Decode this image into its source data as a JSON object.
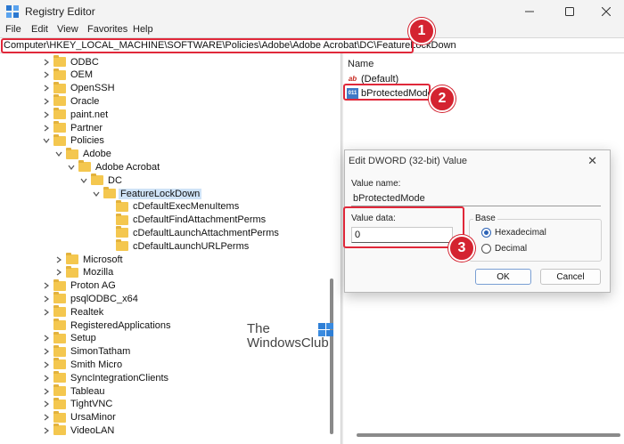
{
  "window": {
    "title": "Registry Editor"
  },
  "menu": [
    "File",
    "Edit",
    "View",
    "Favorites",
    "Help"
  ],
  "address": {
    "path": "Computer\\HKEY_LOCAL_MACHINE\\SOFTWARE\\Policies\\Adobe\\Adobe Acrobat\\DC\\FeatureLockDown"
  },
  "tree": {
    "items": [
      {
        "label": "ODBC",
        "depth": 0,
        "expander": "collapsed"
      },
      {
        "label": "OEM",
        "depth": 0,
        "expander": "collapsed"
      },
      {
        "label": "OpenSSH",
        "depth": 0,
        "expander": "collapsed"
      },
      {
        "label": "Oracle",
        "depth": 0,
        "expander": "collapsed"
      },
      {
        "label": "paint.net",
        "depth": 0,
        "expander": "collapsed"
      },
      {
        "label": "Partner",
        "depth": 0,
        "expander": "collapsed"
      },
      {
        "label": "Policies",
        "depth": 0,
        "expander": "expanded"
      },
      {
        "label": "Adobe",
        "depth": 1,
        "expander": "expanded"
      },
      {
        "label": "Adobe Acrobat",
        "depth": 2,
        "expander": "expanded"
      },
      {
        "label": "DC",
        "depth": 3,
        "expander": "expanded"
      },
      {
        "label": "FeatureLockDown",
        "depth": 4,
        "expander": "expanded",
        "selected": true
      },
      {
        "label": "cDefaultExecMenuItems",
        "depth": 5,
        "expander": "none"
      },
      {
        "label": "cDefaultFindAttachmentPerms",
        "depth": 5,
        "expander": "none"
      },
      {
        "label": "cDefaultLaunchAttachmentPerms",
        "depth": 5,
        "expander": "none"
      },
      {
        "label": "cDefaultLaunchURLPerms",
        "depth": 5,
        "expander": "none"
      },
      {
        "label": "Microsoft",
        "depth": 1,
        "expander": "collapsed"
      },
      {
        "label": "Mozilla",
        "depth": 1,
        "expander": "collapsed"
      },
      {
        "label": "Proton AG",
        "depth": 0,
        "expander": "collapsed"
      },
      {
        "label": "psqlODBC_x64",
        "depth": 0,
        "expander": "collapsed"
      },
      {
        "label": "Realtek",
        "depth": 0,
        "expander": "collapsed"
      },
      {
        "label": "RegisteredApplications",
        "depth": 0,
        "expander": "none"
      },
      {
        "label": "Setup",
        "depth": 0,
        "expander": "collapsed"
      },
      {
        "label": "SimonTatham",
        "depth": 0,
        "expander": "collapsed"
      },
      {
        "label": "Smith Micro",
        "depth": 0,
        "expander": "collapsed"
      },
      {
        "label": "SyncIntegrationClients",
        "depth": 0,
        "expander": "collapsed"
      },
      {
        "label": "Tableau",
        "depth": 0,
        "expander": "collapsed"
      },
      {
        "label": "TightVNC",
        "depth": 0,
        "expander": "collapsed"
      },
      {
        "label": "UrsaMinor",
        "depth": 0,
        "expander": "collapsed"
      },
      {
        "label": "VideoLAN",
        "depth": 0,
        "expander": "collapsed"
      }
    ]
  },
  "values": {
    "column_name": "Name",
    "rows": [
      {
        "label": "(Default)",
        "icon": "string-value-icon",
        "icon_text": "ab"
      },
      {
        "label": "bProtectedMode",
        "icon": "dword-value-icon",
        "icon_text": "011"
      }
    ]
  },
  "dialog": {
    "title": "Edit DWORD (32-bit) Value",
    "close_glyph": "✕",
    "value_name_label": "Value name:",
    "value_name": "bProtectedMode",
    "value_data_label": "Value data:",
    "value_data": "0",
    "base_label": "Base",
    "hex_label": "Hexadecimal",
    "dec_label": "Decimal",
    "base_selected": "Hexadecimal",
    "ok_label": "OK",
    "cancel_label": "Cancel"
  },
  "badges": [
    "1",
    "2",
    "3"
  ],
  "watermark": {
    "line1": "The",
    "line2": "WindowsClub"
  },
  "colors": {
    "highlight": "#e0283a",
    "badge": "#d42330",
    "folder": "#f4c74f",
    "selection": "#cfe3f7"
  }
}
